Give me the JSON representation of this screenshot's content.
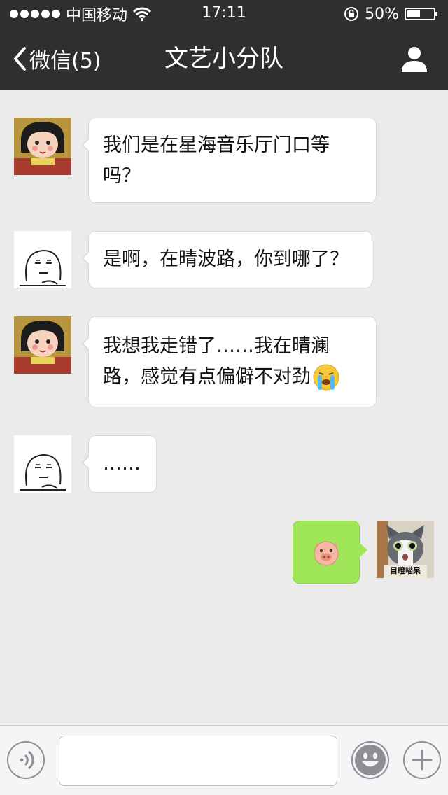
{
  "status_bar": {
    "carrier": "中国移动",
    "time": "17:11",
    "battery_percent": "50%",
    "battery_level": 0.5
  },
  "nav": {
    "back_label": "微信(5)",
    "title": "文艺小分队"
  },
  "messages": [
    {
      "side": "left",
      "avatar": "girl-avatar",
      "text_lines": [
        "我们是在星海音乐厅门口等",
        "吗？"
      ]
    },
    {
      "side": "left",
      "avatar": "sketch-face-avatar",
      "text_lines": [
        "是啊，在晴波路，你到哪了？"
      ]
    },
    {
      "side": "left",
      "avatar": "girl-avatar",
      "text_lines": [
        "我想我走错了……我在晴澜",
        "路，感觉有点偏僻不对劲"
      ],
      "emoji": "crying-emoji"
    },
    {
      "side": "left",
      "avatar": "sketch-face-avatar",
      "text_lines": [
        "……"
      ]
    },
    {
      "side": "right",
      "avatar": "cat-avatar",
      "avatar_caption": "目瞪喵呆",
      "emoji": "pig-emoji"
    }
  ],
  "icons": {
    "back": "chevron-left-icon",
    "profile": "person-icon",
    "voice": "voice-icon",
    "emoji": "smiley-icon",
    "more": "plus-icon",
    "wifi": "wifi-icon",
    "lock": "rotation-lock-icon"
  },
  "colors": {
    "nav_bg": "#2f2f31",
    "chat_bg": "#ebebeb",
    "bubble_in": "#ffffff",
    "bubble_out": "#9fe658"
  }
}
